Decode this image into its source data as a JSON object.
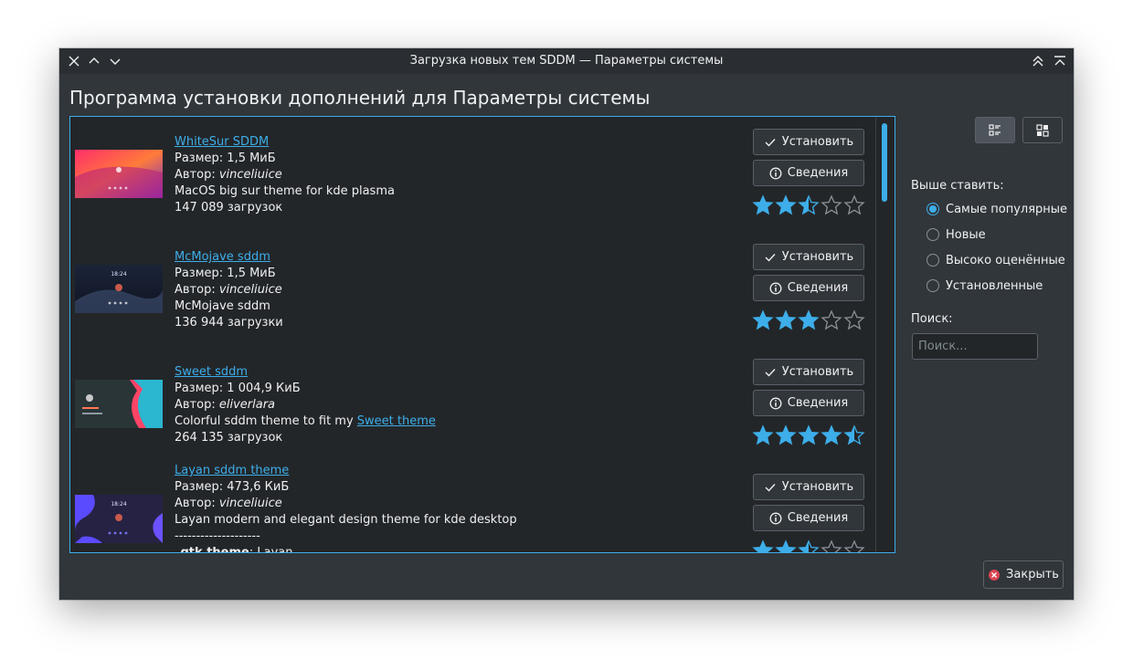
{
  "window": {
    "title": "Загрузка новых тем SDDM — Параметры системы"
  },
  "heading": "Программа установки дополнений для Параметры системы",
  "labels": {
    "install": "Установить",
    "details": "Сведения",
    "sort_label": "Выше ставить:",
    "search_label": "Поиск:",
    "close": "Закрыть"
  },
  "search": {
    "placeholder": "Поиск...",
    "value": ""
  },
  "sort_options": [
    {
      "label": "Самые популярные",
      "checked": true
    },
    {
      "label": "Новые",
      "checked": false
    },
    {
      "label": "Высоко оценённые",
      "checked": false
    },
    {
      "label": "Установленные",
      "checked": false
    }
  ],
  "view_mode": {
    "active": "list"
  },
  "items": [
    {
      "title": "WhiteSur SDDM",
      "size": "Размер: 1,5 МиБ",
      "author_prefix": "Автор: ",
      "author": "vinceliuice",
      "description": "MacOS big sur theme for kde plasma",
      "downloads": "147 089 загрузок",
      "rating": 2.5,
      "thumb_colors": [
        "#ff3d6e",
        "#ff8a3d",
        "#7a2bd6"
      ]
    },
    {
      "title": "McMojave sddm",
      "size": "Размер: 1,5 МиБ",
      "author_prefix": "Автор: ",
      "author": "vinceliuice",
      "description": "McMojave sddm",
      "downloads": "136 944 загрузки",
      "rating": 3,
      "thumb_colors": [
        "#1e2a44",
        "#3a4a6e",
        "#0f1626"
      ]
    },
    {
      "title": "Sweet sddm",
      "size": "Размер: 1 004,9 КиБ",
      "author_prefix": "Автор: ",
      "author": "eliverlara",
      "description": "Colorful sddm theme to fit my ",
      "description_link": " Sweet theme ",
      "downloads": "264 135 загрузок",
      "rating": 4.5,
      "thumb_colors": [
        "#2b3a3f",
        "#ff4d6a",
        "#2ec4d6"
      ]
    },
    {
      "title": "Layan sddm theme",
      "size": "Размер: 473,6 КиБ",
      "author_prefix": "Автор: ",
      "author": "vinceliuice",
      "description": "Layan modern and elegant design theme for kde desktop",
      "separator": "--------------------",
      "extra_bold": "_gtk theme",
      "extra_rest": ": Layan",
      "rating": 2.5,
      "thumb_colors": [
        "#5b4bff",
        "#2a2560",
        "#7a5cff"
      ]
    }
  ],
  "colors": {
    "accent": "#3daee9",
    "background": "#31363b",
    "list_background": "#232629",
    "star_empty": "#8c9196"
  }
}
